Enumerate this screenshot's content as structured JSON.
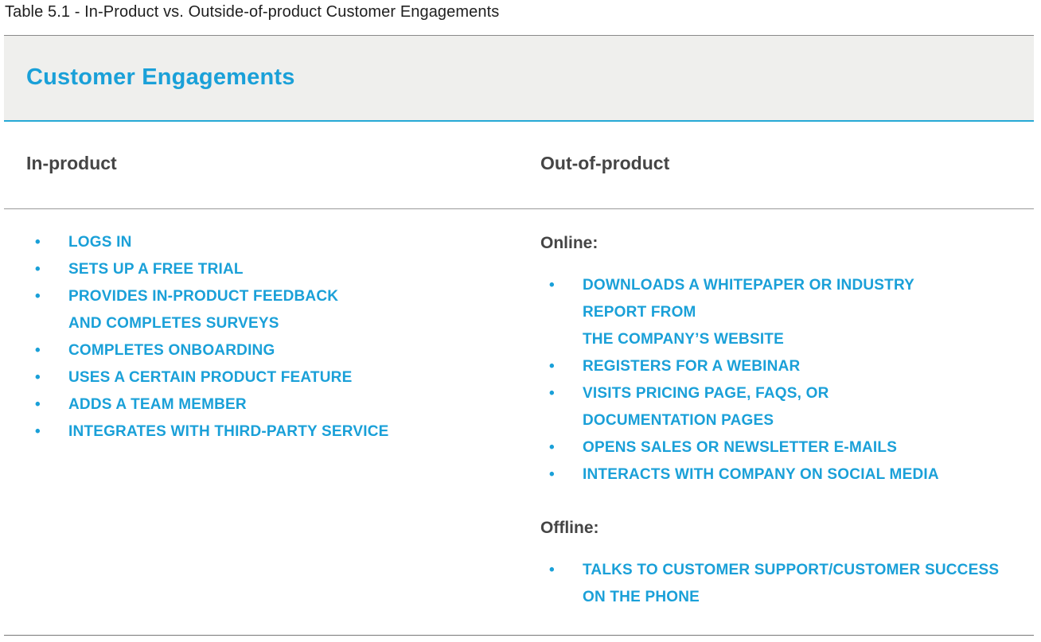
{
  "caption": "Table 5.1 - In-Product vs. Outside-of-product Customer Engagements",
  "banner": {
    "title": "Customer Engagements"
  },
  "columns": {
    "left_heading": "In-product",
    "right_heading": "Out-of-product"
  },
  "in_product": {
    "bullet": "•",
    "items": [
      "Logs in",
      "Sets up a free trial",
      "Provides in-product feedback\nand completes surveys",
      "Completes onboarding",
      "Uses a certain product feature",
      "Adds a team member",
      "Integrates with third-party service"
    ]
  },
  "out_of_product": {
    "online_label": "Online:",
    "online_items": [
      "Downloads a whitepaper or industry\nreport from\nthe company’s website",
      "Registers for a webinar",
      "Visits pricing page, FAQs, or\ndocumentation pages",
      "Opens sales or newsletter e-mails",
      "Interacts with company on social media"
    ],
    "offline_label": "Offline:",
    "offline_items": [
      "Talks to customer support/customer success\non the phone"
    ]
  },
  "colors": {
    "accent": "#1aa0d8",
    "banner_bg": "#efefed",
    "heading_text": "#454545"
  }
}
